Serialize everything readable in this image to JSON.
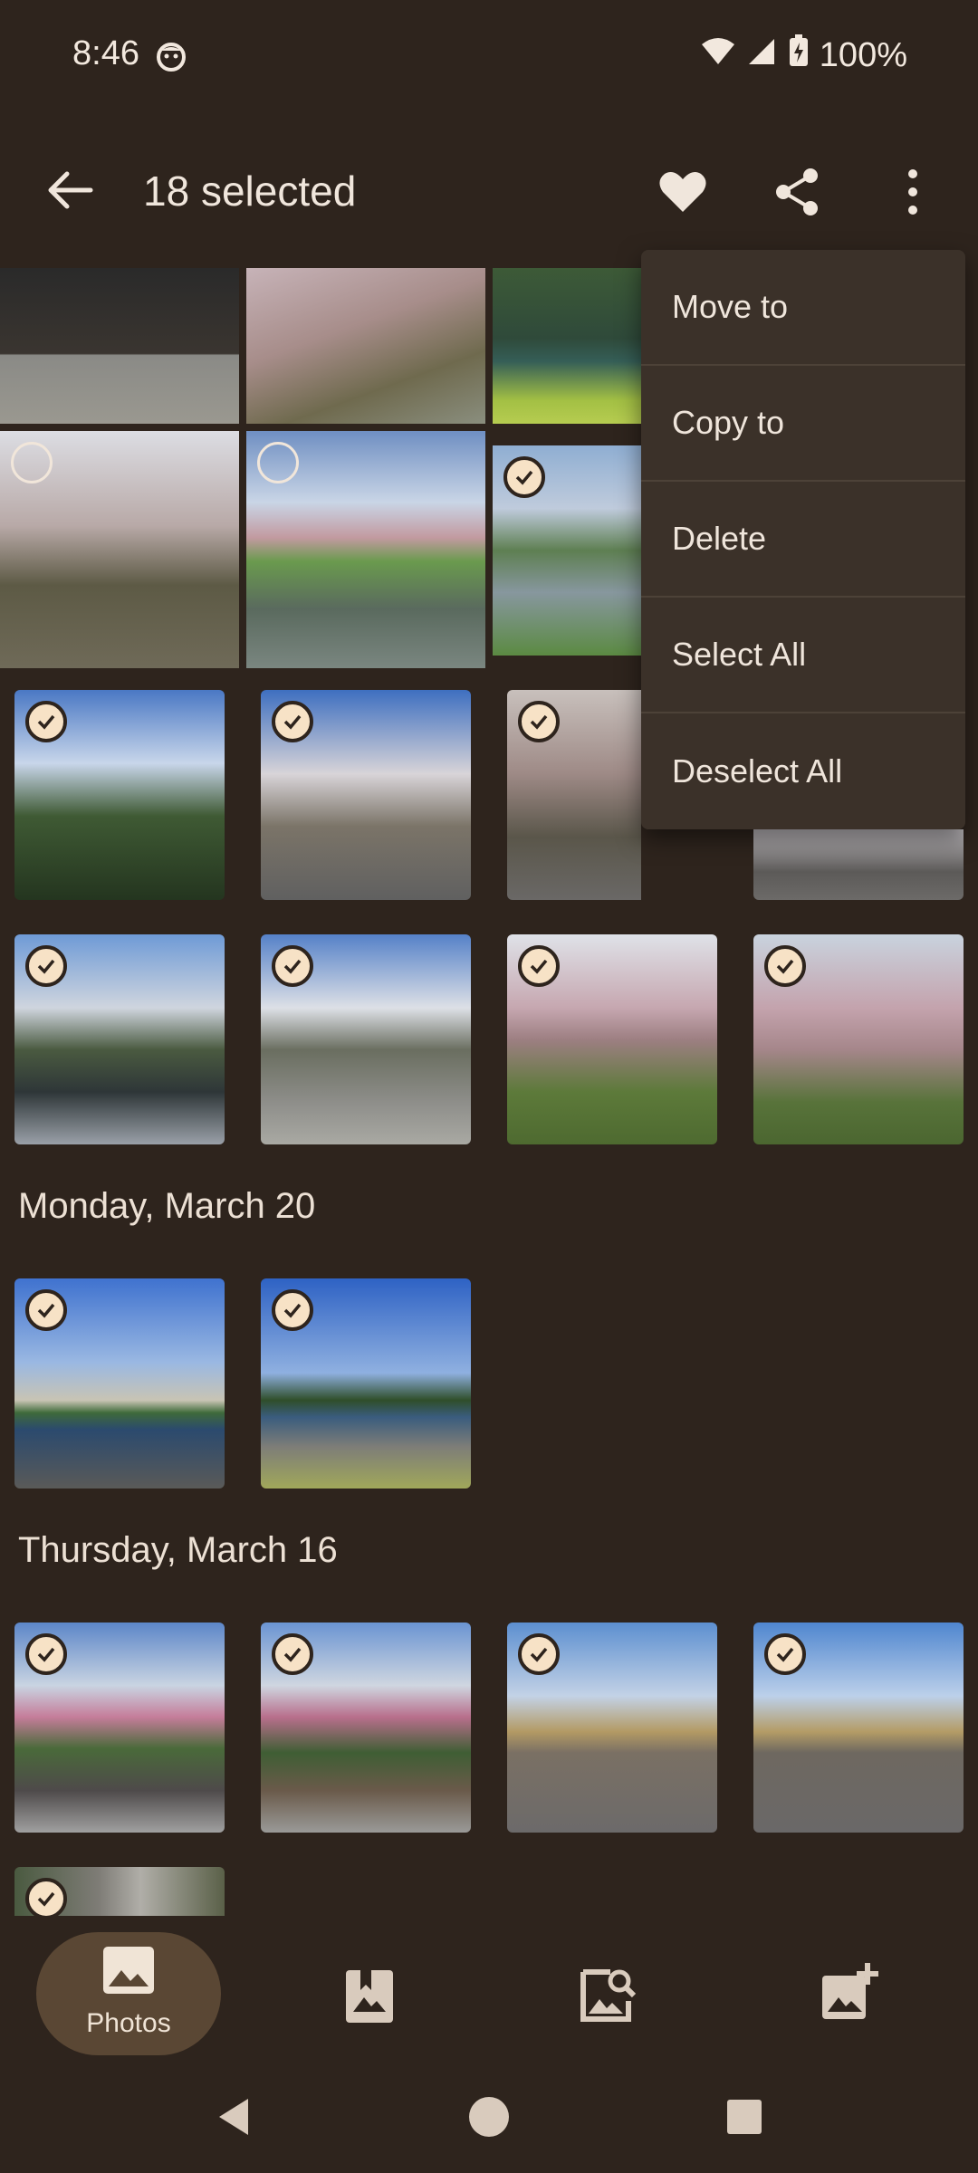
{
  "status": {
    "time": "8:46",
    "battery": "100%"
  },
  "toolbar": {
    "title": "18 selected",
    "back_icon": "back-arrow-icon",
    "favorite_icon": "heart-icon",
    "share_icon": "share-icon",
    "more_icon": "more-vert-icon"
  },
  "menu": {
    "items": [
      {
        "label": "Move to"
      },
      {
        "label": "Copy to"
      },
      {
        "label": "Delete"
      },
      {
        "label": "Select All"
      },
      {
        "label": "Deselect All"
      }
    ]
  },
  "sections": [
    {
      "date": "Monday, March 20"
    },
    {
      "date": "Thursday, March 16"
    }
  ],
  "bottom_nav": {
    "items": [
      {
        "label": "Photos",
        "icon": "photo-icon",
        "selected": true
      },
      {
        "label": "",
        "icon": "albums-icon"
      },
      {
        "label": "",
        "icon": "photo-search-icon"
      },
      {
        "label": "",
        "icon": "add-photo-icon"
      }
    ]
  },
  "colors": {
    "background": "#2e241d",
    "check_fill": "#f7e2c6",
    "menu_bg": "#3b3129",
    "nav_pill": "#5a4734"
  }
}
